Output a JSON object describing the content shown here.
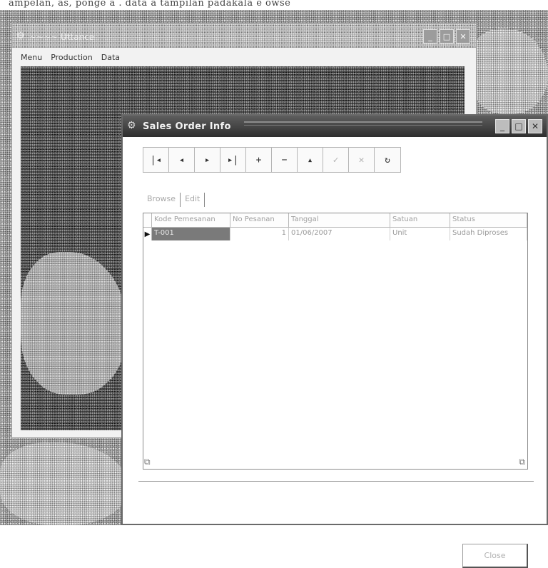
{
  "background_text": "ampelan, as, ponge a . data a tampilan padakala e owse",
  "main_window": {
    "title": "~~~~ Uttance",
    "menu": [
      "Menu",
      "Production",
      "Data"
    ]
  },
  "dialog": {
    "title": "Sales Order Info",
    "navigator": [
      {
        "icon": "first-record-icon",
        "glyph": "|◂"
      },
      {
        "icon": "prior-record-icon",
        "glyph": "◂"
      },
      {
        "icon": "next-record-icon",
        "glyph": "▸"
      },
      {
        "icon": "last-record-icon",
        "glyph": "▸|"
      },
      {
        "icon": "insert-record-icon",
        "glyph": "+"
      },
      {
        "icon": "delete-record-icon",
        "glyph": "−"
      },
      {
        "icon": "edit-record-icon",
        "glyph": "▴"
      },
      {
        "icon": "post-edit-icon",
        "glyph": "✓"
      },
      {
        "icon": "cancel-edit-icon",
        "glyph": "✕"
      },
      {
        "icon": "refresh-data-icon",
        "glyph": "↻"
      }
    ],
    "tabs": [
      "Browse",
      "Edit"
    ],
    "grid": {
      "columns": [
        "Kode Pemesanan",
        "No Pesanan",
        "Tanggal",
        "Satuan",
        "Status"
      ],
      "rows": [
        [
          "T-001",
          "1",
          "01/06/2007",
          "Unit",
          "Sudah Diproses"
        ]
      ]
    },
    "close_label": "Close"
  }
}
